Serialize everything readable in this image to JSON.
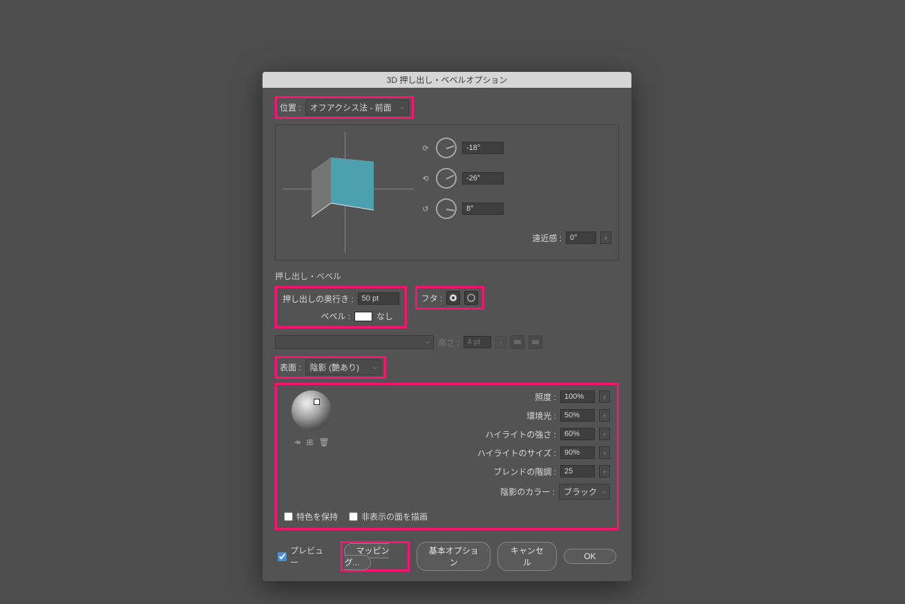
{
  "dialog": {
    "title": "3D 押し出し・ベベルオプション",
    "position": {
      "label": "位置 :",
      "value": "オフアクシス法 - 前面"
    },
    "rotation": {
      "x": "-18°",
      "y": "-26°",
      "z": "8°",
      "perspective_label": "遠近感 :",
      "perspective": "0°"
    },
    "extrude_section": {
      "heading": "押し出し・ベベル",
      "depth_label": "押し出しの奥行き :",
      "depth": "50 pt",
      "bevel_label": "ベベル :",
      "bevel": "なし",
      "cap_label": "フタ :",
      "height_label": "高さ :",
      "height": "4 pt"
    },
    "surface": {
      "label": "表面 :",
      "value": "陰影 (艶あり)"
    },
    "shading": {
      "light_intensity_label": "照度 :",
      "light_intensity": "100%",
      "ambient_label": "環境光 :",
      "ambient": "50%",
      "highlight_intensity_label": "ハイライトの強さ :",
      "highlight_intensity": "60%",
      "highlight_size_label": "ハイライトのサイズ :",
      "highlight_size": "90%",
      "blend_steps_label": "ブレンドの階調 :",
      "blend_steps": "25",
      "shade_color_label": "陰影のカラー :",
      "shade_color": "ブラック"
    },
    "checks": {
      "preserve_spot": "特色を保持",
      "draw_hidden": "非表示の面を描画"
    },
    "footer": {
      "preview": "プレビュー",
      "map_art": "マッピング...",
      "fewer_options": "基本オプション",
      "cancel": "キャンセル",
      "ok": "OK"
    }
  }
}
